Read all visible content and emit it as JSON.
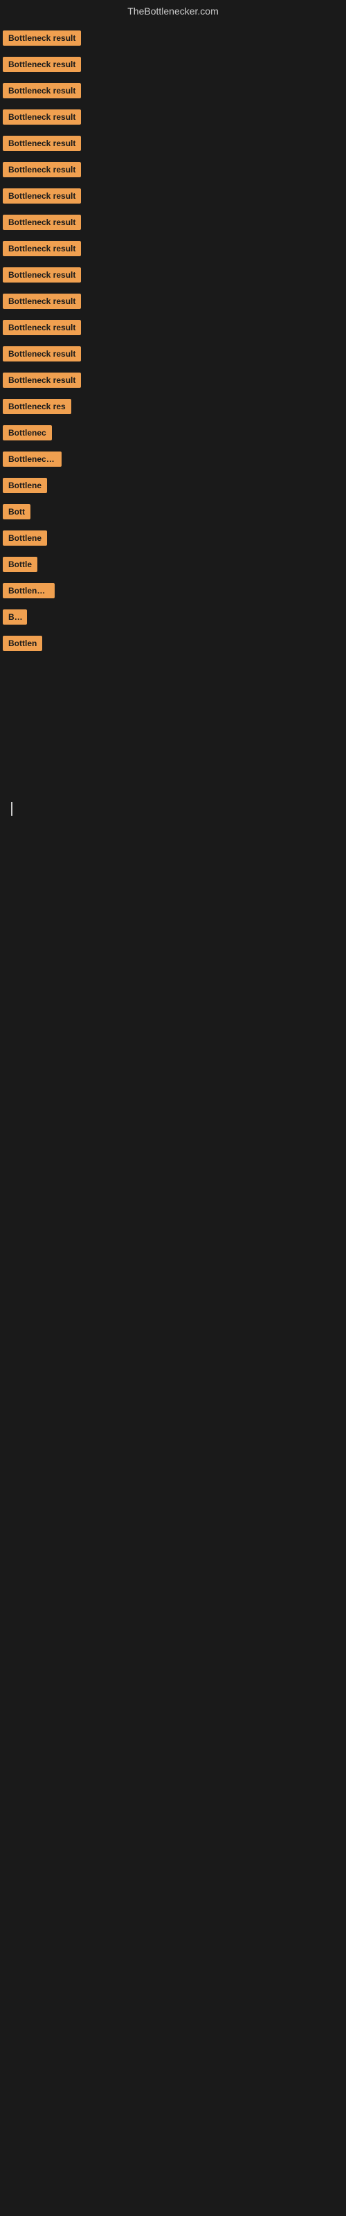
{
  "header": {
    "title": "TheBottlenecker.com"
  },
  "items": [
    {
      "id": 1,
      "label": "Bottleneck result",
      "width": 130
    },
    {
      "id": 2,
      "label": "Bottleneck result",
      "width": 130
    },
    {
      "id": 3,
      "label": "Bottleneck result",
      "width": 130
    },
    {
      "id": 4,
      "label": "Bottleneck result",
      "width": 130
    },
    {
      "id": 5,
      "label": "Bottleneck result",
      "width": 130
    },
    {
      "id": 6,
      "label": "Bottleneck result",
      "width": 130
    },
    {
      "id": 7,
      "label": "Bottleneck result",
      "width": 130
    },
    {
      "id": 8,
      "label": "Bottleneck result",
      "width": 130
    },
    {
      "id": 9,
      "label": "Bottleneck result",
      "width": 130
    },
    {
      "id": 10,
      "label": "Bottleneck result",
      "width": 130
    },
    {
      "id": 11,
      "label": "Bottleneck result",
      "width": 130
    },
    {
      "id": 12,
      "label": "Bottleneck result",
      "width": 130
    },
    {
      "id": 13,
      "label": "Bottleneck result",
      "width": 130
    },
    {
      "id": 14,
      "label": "Bottleneck result",
      "width": 130
    },
    {
      "id": 15,
      "label": "Bottleneck res",
      "width": 105
    },
    {
      "id": 16,
      "label": "Bottlenec",
      "width": 72
    },
    {
      "id": 17,
      "label": "Bottleneck r",
      "width": 85
    },
    {
      "id": 18,
      "label": "Bottlene",
      "width": 65
    },
    {
      "id": 19,
      "label": "Bott",
      "width": 40
    },
    {
      "id": 20,
      "label": "Bottlene",
      "width": 65
    },
    {
      "id": 21,
      "label": "Bottle",
      "width": 52
    },
    {
      "id": 22,
      "label": "Bottleneck",
      "width": 75
    },
    {
      "id": 23,
      "label": "Bot",
      "width": 35
    },
    {
      "id": 24,
      "label": "Bottlen",
      "width": 58
    }
  ],
  "colors": {
    "badge_bg": "#f0a050",
    "badge_text": "#1a1a1a",
    "page_bg": "#1a1a1a",
    "header_text": "#cccccc"
  }
}
